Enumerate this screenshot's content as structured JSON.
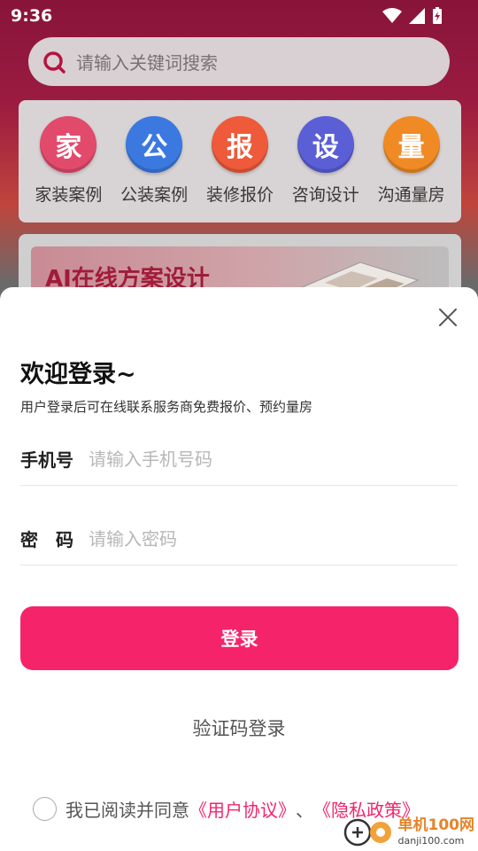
{
  "status_bar": {
    "time": "9:36"
  },
  "search": {
    "placeholder": "请输入关键词搜索"
  },
  "categories": [
    {
      "icon_char": "家",
      "label": "家装案例",
      "color": "#e24a6c"
    },
    {
      "icon_char": "公",
      "label": "公装案例",
      "color": "#3b79e0"
    },
    {
      "icon_char": "报",
      "label": "装修报价",
      "color": "#ee5a3a"
    },
    {
      "icon_char": "设",
      "label": "咨询设计",
      "color": "#5a5fd6"
    },
    {
      "icon_char": "量",
      "label": "沟通量房",
      "color": "#f08a25"
    }
  ],
  "banner": {
    "title": "AI在线方案设计"
  },
  "login": {
    "title": "欢迎登录~",
    "subtitle": "用户登录后可在线联系服务商免费报价、预约量房",
    "phone_label": "手机号",
    "phone_placeholder": "请输入手机号码",
    "password_label": "密　码",
    "password_placeholder": "请输入密码",
    "login_button": "登录",
    "sms_login": "验证码登录",
    "agree_prefix": "我已阅读并同意",
    "user_agreement": "《用户协议》",
    "separator": "、",
    "privacy_policy": "《隐私政策》"
  },
  "watermark": {
    "name": "单机100网",
    "url": "danji100.com"
  },
  "colors": {
    "accent": "#f5246a",
    "header": "#88143a"
  }
}
